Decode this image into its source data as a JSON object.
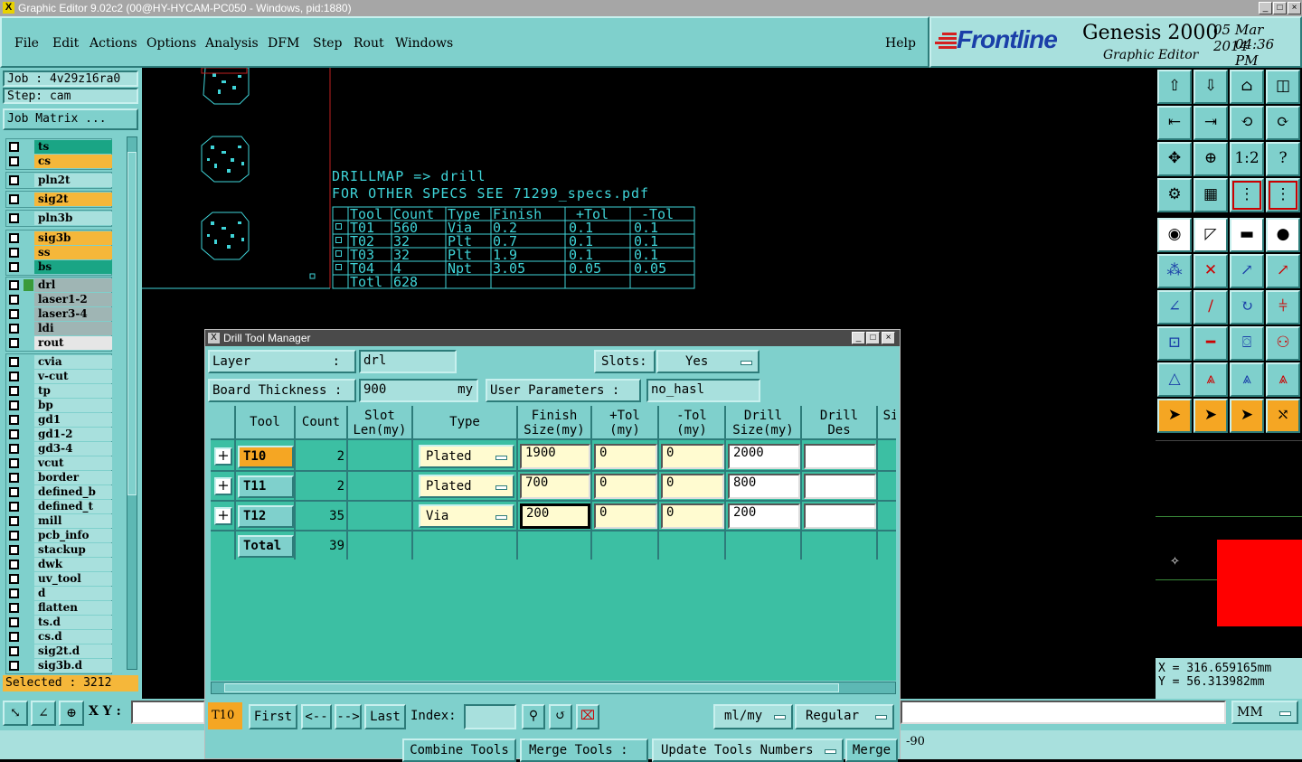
{
  "window": {
    "title": "Graphic Editor 9.02c2 (00@HY-HYCAM-PC050 - Windows, pid:1880)"
  },
  "menu": {
    "items": [
      "File",
      "Edit",
      "Actions",
      "Options",
      "Analysis",
      "DFM",
      "Step",
      "Rout",
      "Windows"
    ],
    "help": "Help"
  },
  "brand": {
    "logo": "Frontline",
    "product": "Genesis 2000",
    "subtitle": "Graphic Editor",
    "date": "05 Mar 2014",
    "time": "04:36 PM"
  },
  "job": {
    "job": "Job : 4v29z16ra0",
    "step": "Step: cam",
    "matrix_btn": "Job Matrix ..."
  },
  "layers": {
    "group1": [
      {
        "name": "ts",
        "color": "#1aa585"
      },
      {
        "name": "cs",
        "color": "#f5b73a"
      }
    ],
    "group2": [
      {
        "name": "pln2t",
        "color": "#a8e0dd"
      }
    ],
    "group3": [
      {
        "name": "sig2t",
        "color": "#f5b73a"
      }
    ],
    "group4": [
      {
        "name": "pln3b",
        "color": "#a8e0dd"
      }
    ],
    "group5": [
      {
        "name": "sig3b",
        "color": "#f5b73a"
      },
      {
        "name": "ss",
        "color": "#f5b73a"
      },
      {
        "name": "bs",
        "color": "#1aa585"
      }
    ],
    "group6": [
      {
        "name": "drl",
        "color": "#9fb5b4"
      },
      {
        "name": "laser1-2",
        "color": "#9fb5b4"
      },
      {
        "name": "laser3-4",
        "color": "#9fb5b4"
      },
      {
        "name": "ldi",
        "color": "#9fb5b4"
      },
      {
        "name": "rout",
        "color": "#e6e6e6"
      }
    ],
    "group7": [
      {
        "name": "cvia"
      },
      {
        "name": "v-cut"
      },
      {
        "name": "tp"
      },
      {
        "name": "bp"
      },
      {
        "name": "gd1"
      },
      {
        "name": "gd1-2"
      },
      {
        "name": "gd3-4"
      },
      {
        "name": "vcut"
      },
      {
        "name": "border"
      },
      {
        "name": "defined_b"
      },
      {
        "name": "defined_t"
      },
      {
        "name": "mill"
      },
      {
        "name": "pcb_info"
      },
      {
        "name": "stackup"
      },
      {
        "name": "dwk"
      },
      {
        "name": "uv_tool"
      },
      {
        "name": "d"
      },
      {
        "name": "flatten"
      },
      {
        "name": "ts.d"
      },
      {
        "name": "cs.d"
      },
      {
        "name": "sig2t.d"
      },
      {
        "name": "sig3b.d"
      }
    ]
  },
  "selected": "Selected : 3212",
  "drillmap": {
    "line1": "DRILLMAP => drill",
    "line2": "FOR OTHER SPECS SEE 71299_specs.pdf",
    "headers": [
      "Tool",
      "Count",
      "Type",
      "Finish",
      "+Tol",
      "-Tol"
    ],
    "rows": [
      {
        "sym": "A",
        "tool": "T01",
        "count": "560",
        "type": "Via",
        "finish": "0.2",
        "ptol": "0.1",
        "mtol": "0.1"
      },
      {
        "sym": "B",
        "tool": "T02",
        "count": "32",
        "type": "Plt",
        "finish": "0.7",
        "ptol": "0.1",
        "mtol": "0.1"
      },
      {
        "sym": "C",
        "tool": "T03",
        "count": "32",
        "type": "Plt",
        "finish": "1.9",
        "ptol": "0.1",
        "mtol": "0.1"
      },
      {
        "sym": "D",
        "tool": "T04",
        "count": "4",
        "type": "Npt",
        "finish": "3.05",
        "ptol": "0.05",
        "mtol": "0.05"
      }
    ],
    "total_label": "Totl",
    "total": "628"
  },
  "coords": {
    "x": "X = 316.659165mm",
    "y": "Y = 56.313982mm"
  },
  "dialog": {
    "title": "Drill Tool Manager",
    "layer_label": "Layer",
    "layer_sep": ":",
    "layer_value": "drl",
    "slots_label": "Slots:",
    "slots_value": "Yes",
    "thickness_label": "Board Thickness :",
    "thickness_value": "900",
    "thickness_unit": "my",
    "user_params_label": "User Parameters :",
    "user_params_value": "no_hasl",
    "columns": [
      "Tool",
      "Count",
      "Slot\nLen(my)",
      "Type",
      "Finish\nSize(my)",
      "+Tol\n(my)",
      "-Tol\n(my)",
      "Drill\nSize(my)",
      "Drill\nDes",
      "Si"
    ],
    "rows": [
      {
        "tool": "T10",
        "count": "2",
        "type": "Plated",
        "finish": "1900",
        "ptol": "0",
        "mtol": "0",
        "drill": "2000",
        "des": ""
      },
      {
        "tool": "T11",
        "count": "2",
        "type": "Plated",
        "finish": "700",
        "ptol": "0",
        "mtol": "0",
        "drill": "800",
        "des": ""
      },
      {
        "tool": "T12",
        "count": "35",
        "type": "Via",
        "finish": "200",
        "ptol": "0",
        "mtol": "0",
        "drill": "200",
        "des": ""
      }
    ],
    "total_label": "Total",
    "total_count": "39",
    "current_tool": "T10",
    "first": "First",
    "prev": "<--",
    "next": "-->",
    "last": "Last",
    "index_label": "Index:",
    "units": "ml/my",
    "mode": "Regular",
    "combine": "Combine Tools",
    "merge_tools": "Merge Tools :",
    "update": "Update Tools Numbers",
    "merge": "Merge"
  },
  "bottom": {
    "xy_label": "X Y :",
    "units": "MM",
    "angle": "-90"
  }
}
